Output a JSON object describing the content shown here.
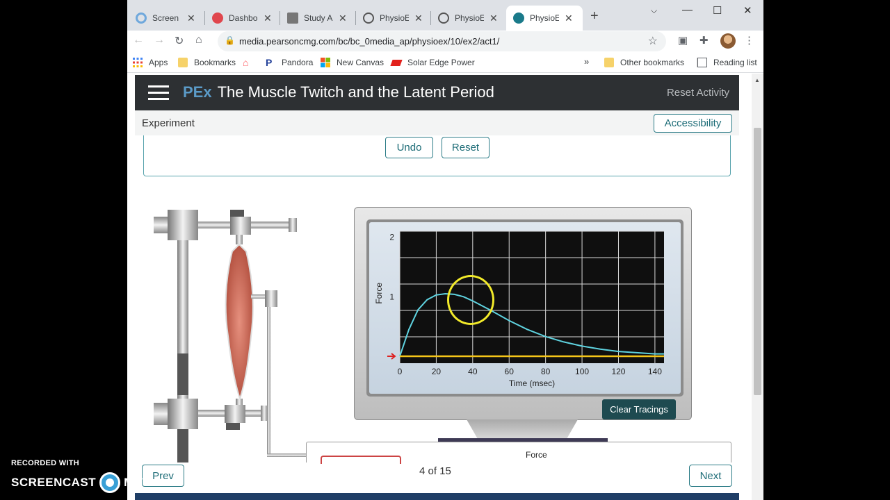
{
  "browser": {
    "tabs": [
      {
        "title": "Screen R",
        "icon": "screencast-icon",
        "color": "#6fa8dc"
      },
      {
        "title": "Dashboa",
        "icon": "canvas-icon",
        "color": "#e0464d"
      },
      {
        "title": "Study Ar",
        "icon": "study-icon",
        "color": "#777777"
      },
      {
        "title": "PhysioEx",
        "icon": "globe-icon",
        "color": "#555555"
      },
      {
        "title": "PhysioEx",
        "icon": "globe-icon",
        "color": "#555555"
      },
      {
        "title": "PhysioEx",
        "icon": "pearson-icon",
        "color": "#1a7a8a"
      }
    ],
    "url": "media.pearsoncmg.com/bc/bc_0media_ap/physioex/10/ex2/act1/",
    "bookmarks": [
      "Apps",
      "Bookmarks",
      "Pandora",
      "New Canvas",
      "Solar Edge Power"
    ],
    "overflow": "»",
    "other_bookmarks": "Other bookmarks",
    "reading_list": "Reading list"
  },
  "header": {
    "brand": "PEx",
    "title": "The Muscle Twitch and the Latent Period",
    "reset": "Reset Activity"
  },
  "subbar": {
    "label": "Experiment",
    "accessibility": "Accessibility"
  },
  "controls": {
    "undo": "Undo",
    "reset": "Reset"
  },
  "monitor": {
    "clear": "Clear Tracings",
    "force_label": "Force"
  },
  "pagination": {
    "prev": "Prev",
    "next": "Next",
    "count": "4 of 15"
  },
  "watermark": {
    "recorded": "RECORDED WITH",
    "brand_left": "SCREENCAST",
    "brand_right": "MATIC"
  },
  "chart_data": {
    "type": "line",
    "xlabel": "Time (msec)",
    "ylabel": "Force",
    "xlim": [
      0,
      145
    ],
    "ylim": [
      0,
      2.1
    ],
    "x_ticks": [
      0,
      20,
      40,
      60,
      80,
      100,
      120,
      140
    ],
    "y_ticks": [
      1,
      2
    ],
    "grid": true,
    "series": [
      {
        "color": "#5fd3e0",
        "x": [
          0,
          5,
          10,
          15,
          20,
          25,
          30,
          35,
          40,
          50,
          60,
          70,
          80,
          90,
          100,
          110,
          120,
          130,
          140,
          145
        ],
        "y": [
          0,
          0.45,
          0.78,
          0.95,
          1.03,
          1.05,
          1.04,
          1.0,
          0.93,
          0.77,
          0.6,
          0.45,
          0.33,
          0.24,
          0.17,
          0.12,
          0.08,
          0.06,
          0.04,
          0.04
        ]
      },
      {
        "color": "#f5c518",
        "x": [
          0,
          145
        ],
        "y": [
          0,
          0
        ]
      }
    ]
  }
}
